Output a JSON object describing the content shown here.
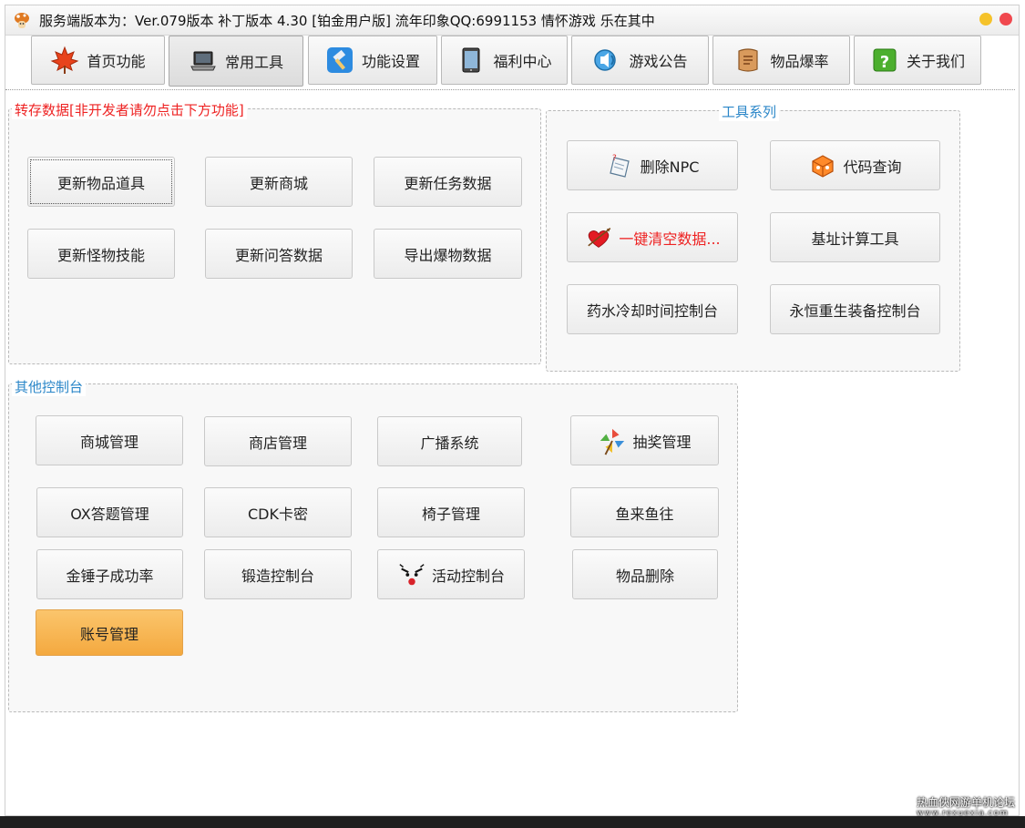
{
  "titlebar": {
    "title": "服务端版本为：Ver.079版本 补丁版本 4.30 [铂金用户版] 流年印象QQ:6991153 情怀游戏 乐在其中"
  },
  "tabs": [
    {
      "label": "首页功能",
      "icon": "maple-leaf-icon"
    },
    {
      "label": "常用工具",
      "icon": "laptop-icon",
      "active": true
    },
    {
      "label": "功能设置",
      "icon": "hammer-icon"
    },
    {
      "label": "福利中心",
      "icon": "tablet-icon"
    },
    {
      "label": "游戏公告",
      "icon": "speaker-icon"
    },
    {
      "label": "物品爆率",
      "icon": "scroll-icon"
    },
    {
      "label": "关于我们",
      "icon": "help-icon"
    }
  ],
  "dump": {
    "title": "转存数据[非开发者请勿点击下方功能]",
    "title_color": "#ee2222",
    "buttons": [
      "更新物品道具",
      "更新商城",
      "更新任务数据",
      "更新怪物技能",
      "更新问答数据",
      "导出爆物数据"
    ]
  },
  "tools": {
    "title": "工具系列",
    "title_color": "#2a86c8",
    "buttons": [
      "删除NPC",
      "代码查询",
      "一键清空数据...",
      "基址计算工具",
      "药水冷却时间控制台",
      "永恒重生装备控制台"
    ]
  },
  "other": {
    "title": "其他控制台",
    "title_color": "#2a86c8",
    "buttons": [
      "商城管理",
      "商店管理",
      "广播系统",
      "抽奖管理",
      "OX答题管理",
      "CDK卡密",
      "椅子管理",
      "鱼来鱼往",
      "金锤子成功率",
      "锻造控制台",
      "活动控制台",
      "物品删除",
      "账号管理"
    ]
  },
  "watermark": {
    "text": "热血俠网游单机论坛",
    "sub": "www.rexuexia.com"
  }
}
